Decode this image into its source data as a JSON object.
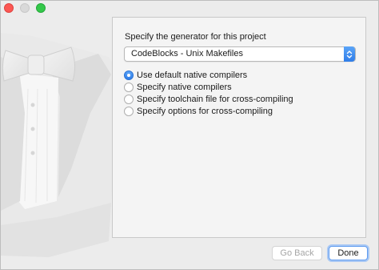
{
  "window": {
    "controls": [
      "close",
      "minimize",
      "zoom"
    ]
  },
  "panel": {
    "prompt": "Specify the generator for this project",
    "generator": {
      "selected": "CodeBlocks - Unix Makefiles",
      "arrow_icon": "up-down-chevron-icon"
    },
    "options": [
      {
        "label": "Use default native compilers",
        "selected": true
      },
      {
        "label": "Specify native compilers",
        "selected": false
      },
      {
        "label": "Specify toolchain file for cross-compiling",
        "selected": false
      },
      {
        "label": "Specify options for cross-compiling",
        "selected": false
      }
    ]
  },
  "buttons": {
    "back_label": "Go Back",
    "back_enabled": false,
    "done_label": "Done"
  },
  "colors": {
    "accent": "#2f7de8",
    "close": "#fc5753",
    "zoom": "#34c84a"
  }
}
